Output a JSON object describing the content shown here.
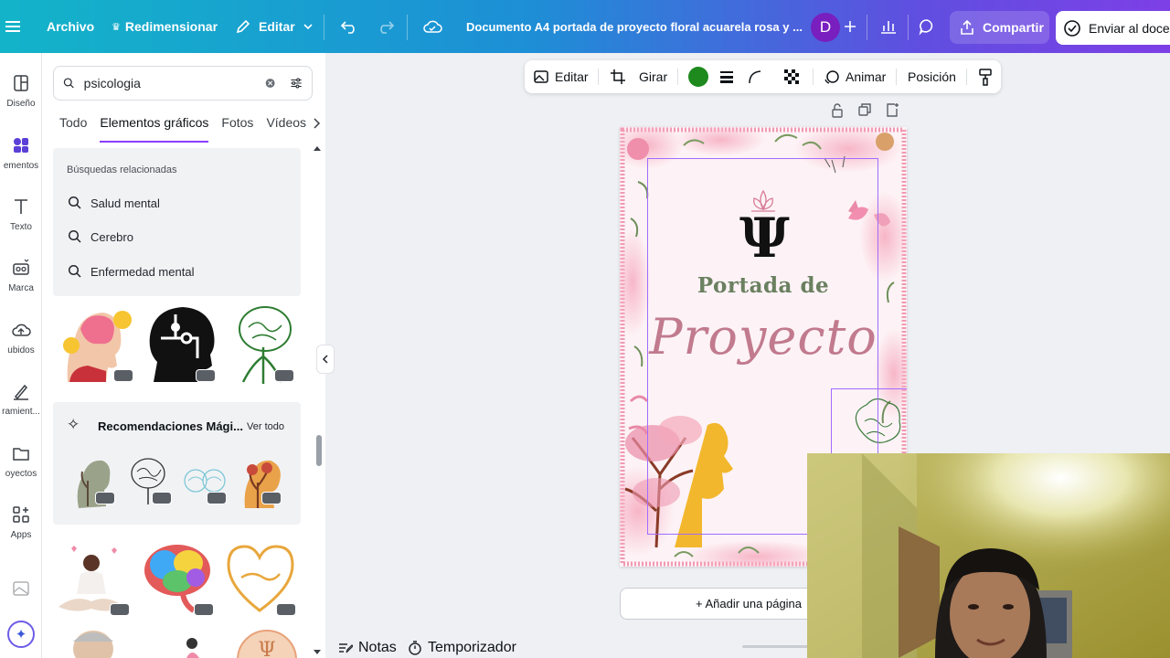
{
  "topbar": {
    "archivo": "Archivo",
    "redimensionar": "Redimensionar",
    "editar": "Editar",
    "document_title": "Documento A4 portada de proyecto floral acuarela rosa y ...",
    "avatar_initial": "D",
    "share_label": "Compartir",
    "send_label": "Enviar al docen"
  },
  "rail": {
    "items": [
      {
        "label": "Diseño",
        "icon": "layout-icon"
      },
      {
        "label": "ementos",
        "icon": "elements-icon"
      },
      {
        "label": "Texto",
        "icon": "text-icon"
      },
      {
        "label": "Marca",
        "icon": "brand-icon"
      },
      {
        "label": "ubidos",
        "icon": "upload-icon"
      },
      {
        "label": "ramient...",
        "icon": "tools-icon"
      },
      {
        "label": "oyectos",
        "icon": "folder-icon"
      },
      {
        "label": "Apps",
        "icon": "apps-icon"
      }
    ]
  },
  "panel": {
    "search_value": "psicologia",
    "tabs": [
      "Todo",
      "Elementos gráficos",
      "Fotos",
      "Vídeos"
    ],
    "active_tab": "Elementos gráficos",
    "related_heading": "Búsquedas relacionadas",
    "related": [
      "Salud mental",
      "Cerebro",
      "Enfermedad mental"
    ],
    "magic_heading": "Recomendaciones Mági...",
    "magic_see_all": "Ver todo"
  },
  "context_toolbar": {
    "edit": "Editar",
    "rotate": "Girar",
    "color": "#1e8a1e",
    "animate": "Animar",
    "position": "Posición"
  },
  "page": {
    "portada": "Portada de",
    "proyecto": "Proyecto",
    "psi": "Ψ"
  },
  "add_page_label": "+ Añadir una página",
  "footer": {
    "notes": "Notas",
    "timer": "Temporizador"
  }
}
